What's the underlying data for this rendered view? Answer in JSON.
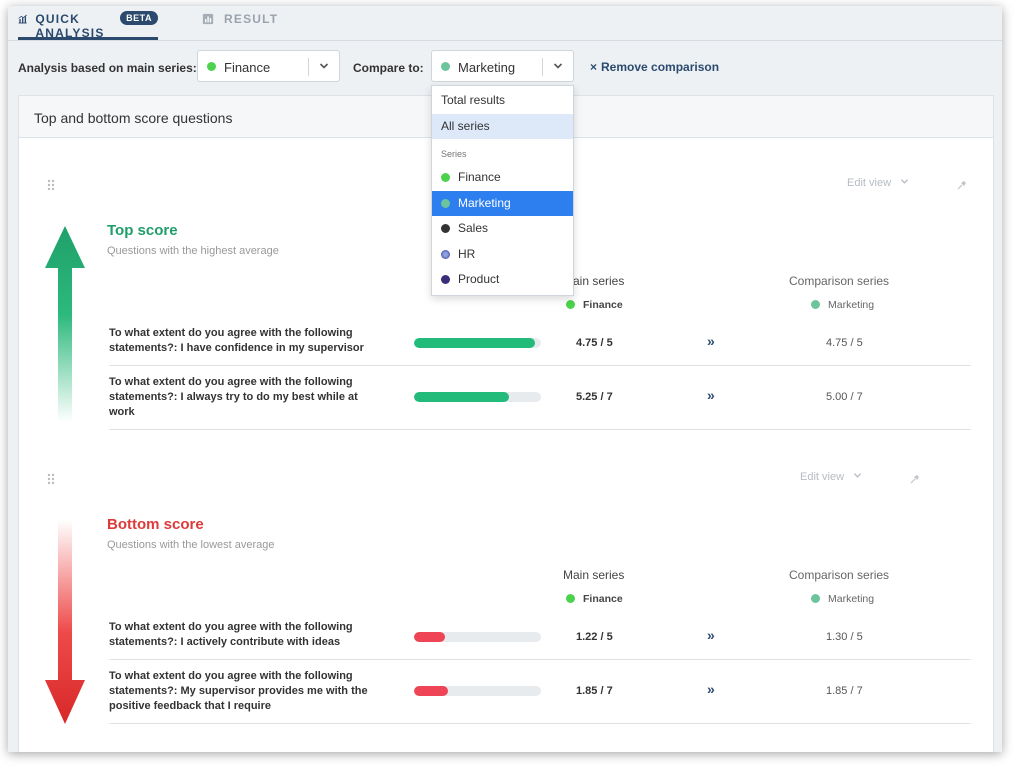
{
  "tabs": {
    "quick_analysis": "QUICK ANALYSIS",
    "beta_badge": "BETA",
    "result": "RESULT"
  },
  "filters": {
    "main_label": "Analysis based on main series:",
    "main_value": "Finance",
    "compare_label": "Compare to:",
    "compare_value": "Marketing",
    "remove_label": "Remove comparison",
    "remove_icon": "×"
  },
  "card": {
    "title": "Top and bottom score questions"
  },
  "dropdown": {
    "items": [
      {
        "label": "Total results"
      },
      {
        "label": "All series"
      }
    ],
    "group_label": "Series",
    "series": [
      {
        "label": "Finance",
        "color": "#4cd24c"
      },
      {
        "label": "Marketing",
        "color": "#6cc49c"
      },
      {
        "label": "Sales",
        "color": "#333333"
      },
      {
        "label": "HR",
        "color": "#4a5fb0"
      },
      {
        "label": "Product",
        "color": "#3b2d7a"
      }
    ]
  },
  "top": {
    "edit_view": "Edit view",
    "title": "Top score",
    "subtitle": "Questions with the highest average",
    "main_series_head": "Main series",
    "comparison_head": "Comparison series",
    "main_series": "Finance",
    "comparison_series": "Marketing",
    "rows": [
      {
        "question": "To what extent do you agree with the following statements?: I have confidence in my supervisor",
        "score": "4.75 / 5",
        "compare": "4.75 / 5",
        "fraction": 0.95
      },
      {
        "question": "To what extent do you agree with the following statements?: I always try to do my best while at work",
        "score": "5.25 / 7",
        "compare": "5.00 / 7",
        "fraction": 0.75
      }
    ]
  },
  "bottom": {
    "edit_view": "Edit view",
    "title": "Bottom score",
    "subtitle": "Questions with the lowest average",
    "main_series_head": "Main series",
    "comparison_head": "Comparison series",
    "main_series": "Finance",
    "comparison_series": "Marketing",
    "rows": [
      {
        "question": "To what extent do you agree with the following statements?: I actively contribute with ideas",
        "score": "1.22 / 5",
        "compare": "1.30 / 5",
        "fraction": 0.244
      },
      {
        "question": "To what extent do you agree with the following statements?: My supervisor provides me with the positive feedback that I require",
        "score": "1.85 / 7",
        "compare": "1.85 / 7",
        "fraction": 0.264
      }
    ]
  },
  "colors": {
    "accent": "#2b4a6e",
    "top": "#1f9e6b",
    "bottom": "#dd3a3a",
    "bar_green": "#22bb7a",
    "bar_red": "#ee4455",
    "highlight": "#2d7ff0",
    "hover": "#dde9f9"
  },
  "icons": {
    "arrows": "»"
  }
}
